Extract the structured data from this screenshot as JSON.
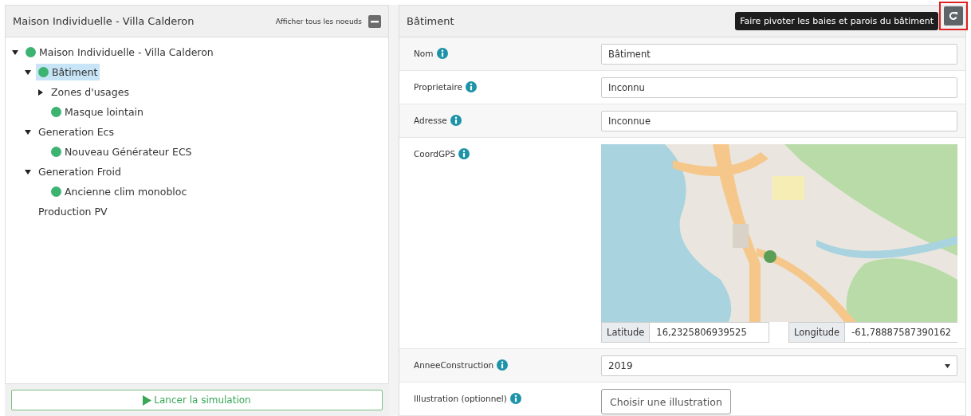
{
  "tree_panel": {
    "title": "Maison Individuelle - Villa Calderon",
    "show_all_label": "Afficher tous les noeuds",
    "tree": [
      {
        "label": "Maison Individuelle - Villa Calderon",
        "kind": "branch",
        "expanded": true,
        "selected": false,
        "color": "#3cb371",
        "children": [
          {
            "label": "Bâtiment",
            "kind": "branch",
            "expanded": true,
            "selected": true,
            "color": "#3cb371",
            "children": [
              {
                "label": "Zones d'usages",
                "kind": "branch",
                "expanded": false,
                "selected": false
              },
              {
                "label": "Masque lointain",
                "kind": "leaf",
                "selected": false,
                "color": "#3cb371"
              }
            ]
          },
          {
            "label": "Generation Ecs",
            "kind": "branch",
            "expanded": true,
            "selected": false,
            "children": [
              {
                "label": "Nouveau Générateur ECS",
                "kind": "leaf",
                "selected": false,
                "color": "#3cb371"
              }
            ]
          },
          {
            "label": "Generation Froid",
            "kind": "branch",
            "expanded": true,
            "selected": false,
            "children": [
              {
                "label": "Ancienne clim monobloc",
                "kind": "leaf",
                "selected": false,
                "color": "#3cb371"
              }
            ]
          },
          {
            "label": "Production PV",
            "kind": "leaf",
            "selected": false
          }
        ]
      }
    ],
    "run_button": "Lancer la simulation"
  },
  "detail_panel": {
    "title": "Bâtiment",
    "tooltip": "Faire pivoter les baies et parois du bâtiment",
    "fields": [
      {
        "kind": "text",
        "label": "Nom",
        "value": "Bâtiment"
      },
      {
        "kind": "text",
        "label": "Proprietaire",
        "value": "Inconnu"
      },
      {
        "kind": "text",
        "label": "Adresse",
        "value": "Inconnue"
      },
      {
        "kind": "map",
        "label": "CoordGPS",
        "latitude_label": "Latitude",
        "latitude": "16,2325806939525",
        "longitude_label": "Longitude",
        "longitude": "-61,78887587390162"
      },
      {
        "kind": "select",
        "label": "AnneeConstruction",
        "value": "2019"
      },
      {
        "kind": "file",
        "label": "Illustration (optionnel)",
        "button": "Choisir une illustration"
      }
    ]
  }
}
